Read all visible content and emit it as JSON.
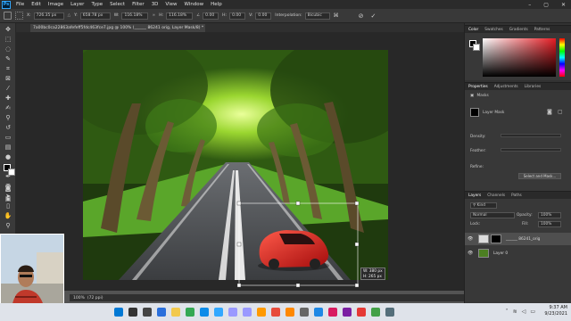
{
  "menubar": {
    "logo": "Ps",
    "items": [
      "File",
      "Edit",
      "Image",
      "Layer",
      "Type",
      "Select",
      "Filter",
      "3D",
      "View",
      "Window",
      "Help"
    ]
  },
  "options": {
    "x_label": "X:",
    "x_value": "726.35 px",
    "y_label": "Y:",
    "y_value": "658.78 px",
    "w_label": "W:",
    "w_value": "116.18%",
    "h_label": "H:",
    "h_value": "116.18%",
    "angle_value": "0.00",
    "h_skew_label": "H:",
    "h_skew_value": "0.00",
    "v_skew_label": "V:",
    "v_skew_value": "0.00",
    "interpolation_label": "Interpolation:",
    "interpolation_value": "Bicubic"
  },
  "document": {
    "tab_title": "7a00bc0ca22863afefeff5fdc463fce7.jpg @ 100% (______ 86241 orig, Layer Mask/8) *",
    "transform_w": "W: 380 px",
    "transform_h": "H: 265 px",
    "zoom": "100%",
    "doc_info": "(72 ppi)"
  },
  "color_panel": {
    "tabs": [
      "Color",
      "Swatches",
      "Gradients",
      "Patterns"
    ],
    "active_tab": "Color",
    "foreground": "#000000",
    "background": "#ffffff",
    "hue": "#e51c23"
  },
  "properties_panel": {
    "tabs": [
      "Properties",
      "Adjustments",
      "Libraries"
    ],
    "active_tab": "Properties",
    "section": "Masks",
    "mask_label": "Layer Mask",
    "density_label": "Density:",
    "feather_label": "Feather:",
    "refine_label": "Refine:",
    "select_mask_button": "Select and Mask..."
  },
  "layers_panel": {
    "tabs": [
      "Layers",
      "Channels",
      "Paths"
    ],
    "active_tab": "Layers",
    "filter_kind": "Kind",
    "blend_mode": "Normal",
    "opacity_label": "Opacity:",
    "opacity_value": "100%",
    "lock_label": "Lock:",
    "fill_label": "Fill:",
    "fill_value": "100%",
    "layers": [
      {
        "name": "______ 86241_orig",
        "selected": true
      },
      {
        "name": "Layer 0",
        "selected": false
      }
    ]
  },
  "taskbar": {
    "time": "9:37 AM",
    "date": "9/23/2021",
    "icons": [
      "windows-icon",
      "search-icon",
      "task-view-icon",
      "widgets-icon",
      "explorer-icon",
      "chrome-icon",
      "edge-icon",
      "photoshop-icon",
      "premiere-icon",
      "aftereffects-icon",
      "illustrator-icon",
      "media-icon",
      "vlc-icon",
      "settings-icon",
      "photos-icon",
      "app-icon",
      "app2-icon",
      "app3-icon",
      "app4-icon",
      "app5-icon"
    ],
    "icon_colors": [
      "#0078d4",
      "#333333",
      "#444444",
      "#2a6fdb",
      "#f2c94c",
      "#34a853",
      "#0c8ce9",
      "#31a8ff",
      "#9999ff",
      "#9999ff",
      "#ff9a00",
      "#e74c3c",
      "#ff8800",
      "#666666",
      "#1e88e5",
      "#d81b60",
      "#7b1fa2",
      "#e53935",
      "#43a047",
      "#546e7a"
    ]
  }
}
